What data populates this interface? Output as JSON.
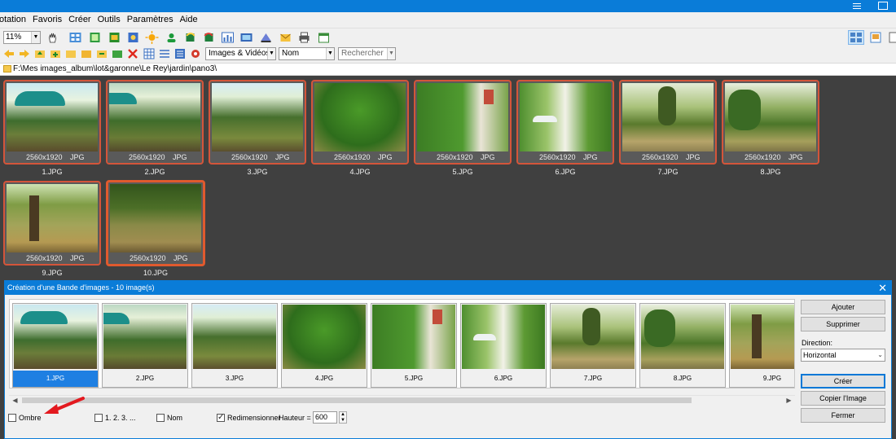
{
  "menu": [
    "otation",
    "Favoris",
    "Créer",
    "Outils",
    "Paramètres",
    "Aide"
  ],
  "toolbar": {
    "zoom": "11%",
    "filter": "Images & Vidéos",
    "sort": "Nom",
    "search_placeholder": "Rechercher"
  },
  "path": "F:\\Mes images_album\\lot&garonne\\Le Rey\\jardin\\pano3\\",
  "files": [
    {
      "name": "1.JPG",
      "res": "2560x1920",
      "fmt": "JPG"
    },
    {
      "name": "2.JPG",
      "res": "2560x1920",
      "fmt": "JPG"
    },
    {
      "name": "3.JPG",
      "res": "2560x1920",
      "fmt": "JPG"
    },
    {
      "name": "4.JPG",
      "res": "2560x1920",
      "fmt": "JPG"
    },
    {
      "name": "5.JPG",
      "res": "2560x1920",
      "fmt": "JPG"
    },
    {
      "name": "6.JPG",
      "res": "2560x1920",
      "fmt": "JPG"
    },
    {
      "name": "7.JPG",
      "res": "2560x1920",
      "fmt": "JPG"
    },
    {
      "name": "8.JPG",
      "res": "2560x1920",
      "fmt": "JPG"
    },
    {
      "name": "9.JPG",
      "res": "2560x1920",
      "fmt": "JPG"
    },
    {
      "name": "10.JPG",
      "res": "2560x1920",
      "fmt": "JPG"
    }
  ],
  "dialog": {
    "title": "Création d'une Bande d'images  -  10 image(s)",
    "strip": [
      "1.JPG",
      "2.JPG",
      "3.JPG",
      "4.JPG",
      "5.JPG",
      "6.JPG",
      "7.JPG",
      "8.JPG",
      "9.JPG"
    ],
    "buttons": {
      "add": "Ajouter",
      "remove": "Supprimer",
      "create": "Créer",
      "copy": "Copier l'Image",
      "close": "Fermer"
    },
    "direction_label": "Direction:",
    "direction_value": "Horizontal",
    "options": {
      "shadow": "Ombre",
      "numbering": "1. 2. 3. ...",
      "name": "Nom",
      "resize": "Redimensionner",
      "height_label": "Hauteur =",
      "height_value": "600"
    }
  }
}
